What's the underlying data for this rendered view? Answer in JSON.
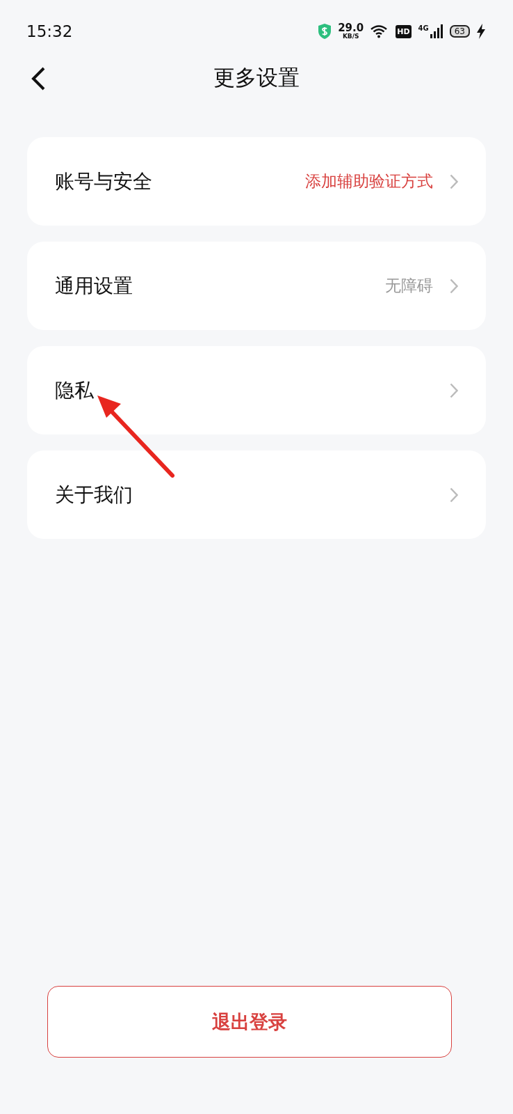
{
  "status_bar": {
    "time": "15:32",
    "speed_value": "29.0",
    "speed_unit": "KB/S",
    "hd": "HD",
    "network": "4G",
    "battery": "63"
  },
  "header": {
    "title": "更多设置"
  },
  "settings": [
    {
      "label": "账号与安全",
      "value": "添加辅助验证方式",
      "color": "#d8413f"
    },
    {
      "label": "通用设置",
      "value": "无障碍",
      "color": "#999999"
    },
    {
      "label": "隐私"
    },
    {
      "label": "关于我们"
    }
  ],
  "logout_button": "退出登录",
  "annotations": [
    {
      "kind": "arrow"
    }
  ]
}
